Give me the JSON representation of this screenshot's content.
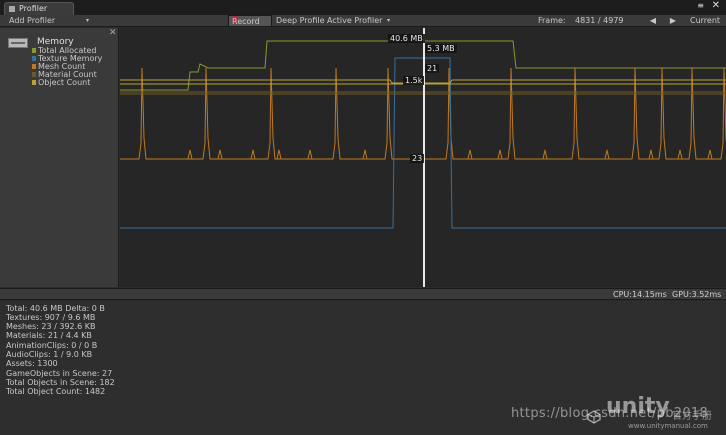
{
  "window": {
    "tab_title": "Profiler",
    "menu_glyph": "≡",
    "close_glyph": "✕"
  },
  "toolbar": {
    "add_profiler": "Add Profiler",
    "dropdown_glyph": "▾",
    "record": "Record",
    "deep_profile": "Deep Profile",
    "active_profiler": "Active Profiler",
    "frame_label": "Frame:",
    "frame_value": "4831 / 4979",
    "prev_glyph": "◀",
    "next_glyph": "▶",
    "current": "Current"
  },
  "memory_panel": {
    "title": "Memory",
    "close_glyph": "✕",
    "legend": [
      {
        "label": "Total Allocated",
        "color": "#8a9a2c"
      },
      {
        "label": "Texture Memory",
        "color": "#3a6f9a"
      },
      {
        "label": "Mesh Count",
        "color": "#c07a22"
      },
      {
        "label": "Material Count",
        "color": "#6d5a2a"
      },
      {
        "label": "Object Count",
        "color": "#b8a23a"
      }
    ]
  },
  "graph_tags": {
    "total": "40.6 MB",
    "texture": "5.3 MB",
    "material": "21",
    "objects": "1.5k",
    "mesh": "23"
  },
  "chart_data": {
    "type": "line",
    "title": "",
    "series": [
      {
        "name": "Total Allocated",
        "color": "#8a9a2c"
      },
      {
        "name": "Texture Memory",
        "color": "#3a6f9a"
      },
      {
        "name": "Mesh Count",
        "color": "#c07a22"
      },
      {
        "name": "Material Count",
        "color": "#6d5a2a"
      },
      {
        "name": "Object Count",
        "color": "#b8a23a"
      }
    ],
    "grid": false
  },
  "status": {
    "cpu": "CPU:14.15ms",
    "gpu": "GPU:3.52ms"
  },
  "details": [
    "Total: 40.6 MB Delta: 0 B",
    "Textures: 907 / 9.6 MB",
    "Meshes: 23 / 392.6 KB",
    "Materials: 21 / 4.4 KB",
    "AnimationClips: 0 / 0 B",
    "AudioClips: 1 / 9.0 KB",
    "Assets: 1300",
    "GameObjects in Scene: 27",
    "Total Objects in Scene: 182",
    "Total Object Count: 1482"
  ],
  "watermark": {
    "blog": "https://blog.csdn.net/pb2018",
    "brand": "unity",
    "brand_cn": "官方手册",
    "url": "www.unitymanual.com"
  }
}
